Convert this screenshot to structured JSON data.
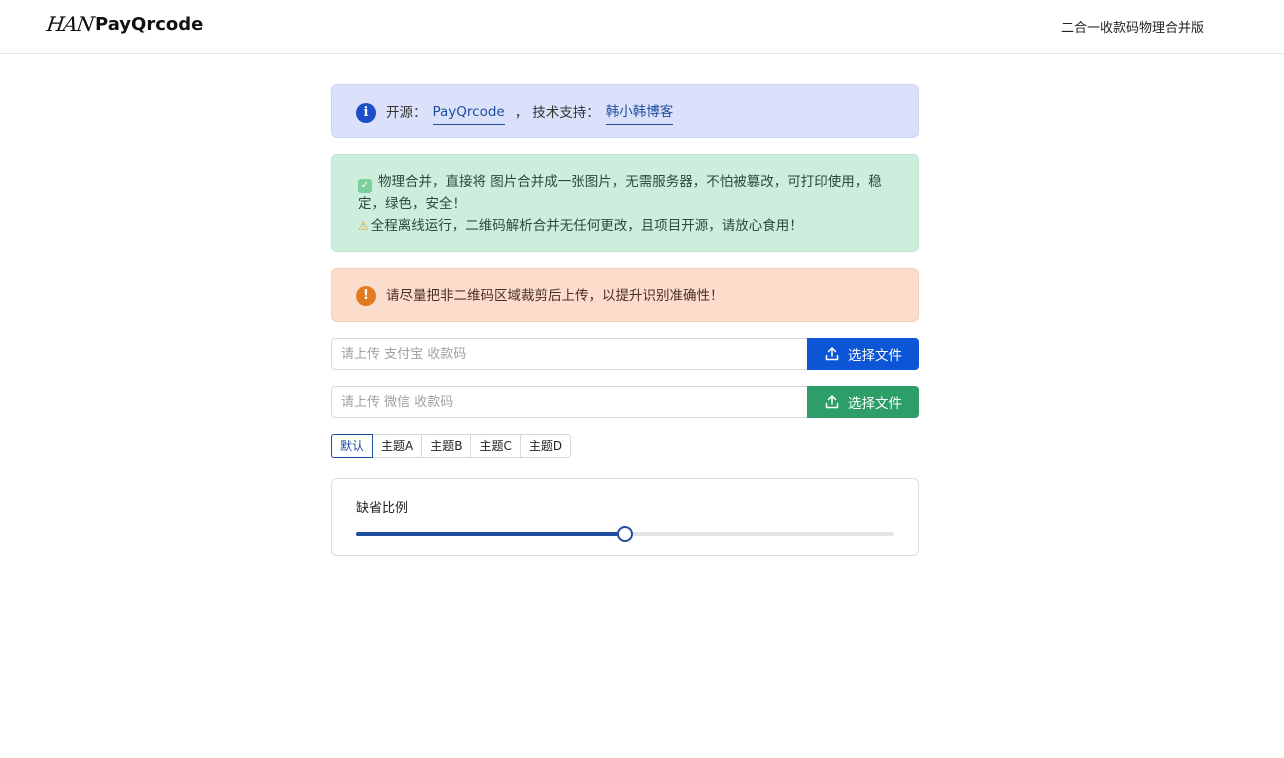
{
  "header": {
    "logo_mark": "HAN",
    "brand": "PayQrcode",
    "right_text": "二合一收款码物理合并版"
  },
  "info_alert": {
    "icon": "info-icon",
    "prefix": "开源：",
    "open_source_link": "PayQrcode",
    "separator": "，",
    "support_label": "技术支持：",
    "support_link": "韩小韩博客"
  },
  "success_alert": {
    "line1_icon": "check-icon",
    "line1": "物理合并，直接将 图片合并成一张图片，无需服务器，不怕被篡改，可打印使用，稳定，绿色，安全！",
    "line2_icon": "warning-triangle-icon",
    "line2": "全程离线运行，二维码解析合并无任何更改，且项目开源，请放心食用！"
  },
  "warning_alert": {
    "icon": "exclamation-icon",
    "text": "请尽量把非二维码区域裁剪后上传，以提升识别准确性！"
  },
  "uploads": [
    {
      "placeholder": "请上传 支付宝 收款码",
      "value": "",
      "button_label": "选择文件",
      "color": "#0b55d6"
    },
    {
      "placeholder": "请上传 微信 收款码",
      "value": "",
      "button_label": "选择文件",
      "color": "#2e9e68"
    }
  ],
  "themes": {
    "options": [
      "默认",
      "主题A",
      "主题B",
      "主题C",
      "主题D"
    ],
    "selected": "默认"
  },
  "scale": {
    "label": "缺省比例",
    "value_fraction": 0.5
  },
  "colors": {
    "accent": "#1f4e9e",
    "info_bg": "#dbe0fb",
    "success_bg": "#cdeedd",
    "warning_bg": "#fcdccb"
  }
}
